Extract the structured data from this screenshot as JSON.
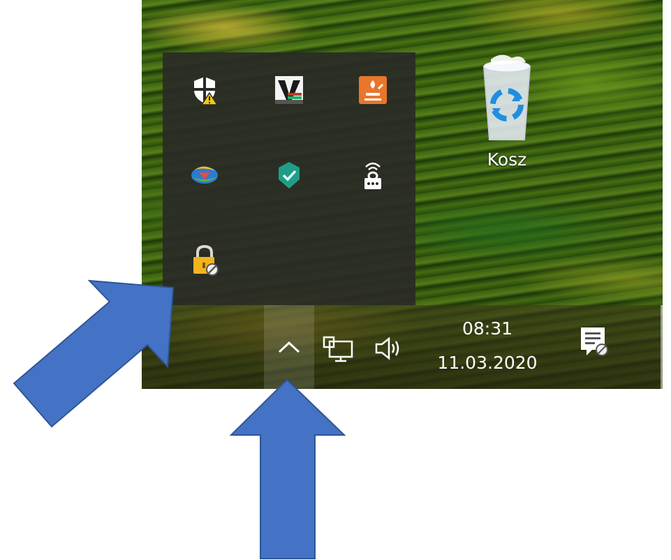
{
  "desktop": {
    "recycle_bin": {
      "label": "Kosz",
      "icon": "recycle-bin-icon"
    }
  },
  "tray_overflow": {
    "icons": [
      {
        "name": "windows-security-warning-icon"
      },
      {
        "name": "veracrypt-icon"
      },
      {
        "name": "java-update-icon"
      },
      {
        "name": "internet-download-manager-icon"
      },
      {
        "name": "antivirus-shield-icon"
      },
      {
        "name": "vpn-lock-icon"
      },
      {
        "name": "padlock-blocked-icon"
      }
    ]
  },
  "taskbar": {
    "show_hidden_icons": "chevron-up-icon",
    "network": "network-wired-icon",
    "volume": "speaker-icon",
    "clock": {
      "time": "08:31",
      "date": "11.03.2020"
    },
    "notifications": "action-center-icon"
  },
  "annotations": {
    "arrow_color": "#4472c4",
    "arrows": [
      "arrow-to-tray-panel",
      "arrow-to-chevron-button"
    ]
  }
}
